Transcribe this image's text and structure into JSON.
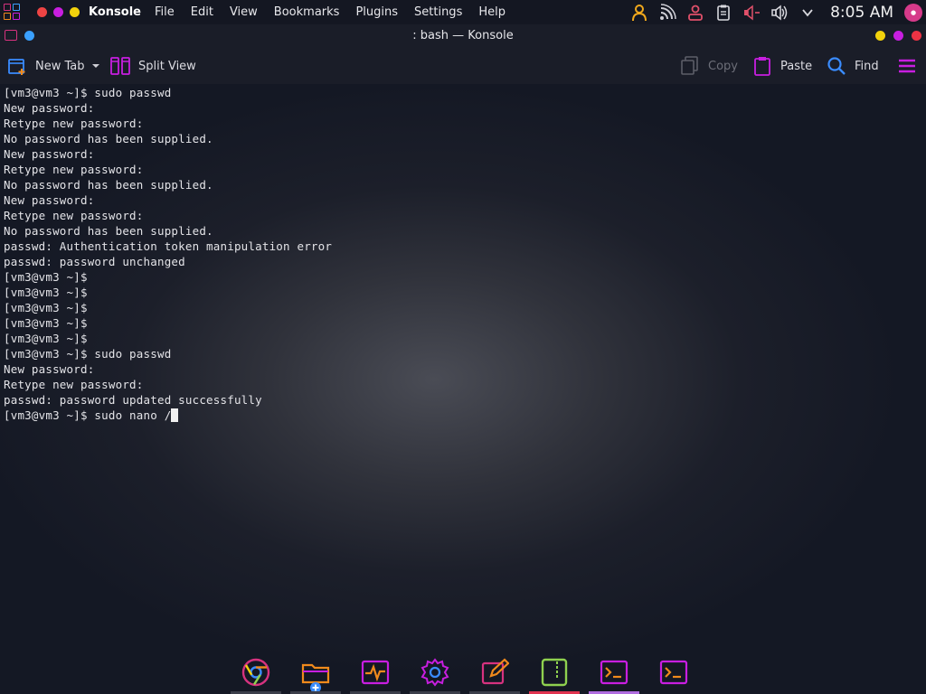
{
  "topbar": {
    "app_name": "Konsole",
    "menu": [
      "File",
      "Edit",
      "View",
      "Bookmarks",
      "Plugins",
      "Settings",
      "Help"
    ],
    "clock": "8:05 AM",
    "tray_icons": [
      "user-icon",
      "wifi-icon",
      "person-icon",
      "clipboard-icon",
      "microphone-icon",
      "volume-icon",
      "chevron-down-icon"
    ]
  },
  "window": {
    "title": ": bash — Konsole",
    "traffic_colors": [
      "#ee4444",
      "#c81ee0",
      "#f2d20c"
    ],
    "right_buttons": [
      "#f2d20c",
      "#c81ee0",
      "#ee3344"
    ]
  },
  "toolbar": {
    "new_tab": "New Tab",
    "split_view": "Split View",
    "copy": "Copy",
    "paste": "Paste",
    "find": "Find"
  },
  "terminal": {
    "lines": [
      "[vm3@vm3 ~]$ sudo passwd",
      "New password:",
      "Retype new password:",
      "No password has been supplied.",
      "New password:",
      "Retype new password:",
      "No password has been supplied.",
      "New password:",
      "Retype new password:",
      "No password has been supplied.",
      "passwd: Authentication token manipulation error",
      "passwd: password unchanged",
      "[vm3@vm3 ~]$",
      "[vm3@vm3 ~]$",
      "[vm3@vm3 ~]$",
      "[vm3@vm3 ~]$",
      "[vm3@vm3 ~]$",
      "[vm3@vm3 ~]$ sudo passwd",
      "New password:",
      "Retype new password:",
      "passwd: password updated successfully"
    ],
    "current_line": "[vm3@vm3 ~]$ sudo nano /"
  },
  "dock": {
    "items": [
      "chrome-icon",
      "files-icon",
      "system-monitor-icon",
      "settings-icon",
      "text-editor-icon",
      "archive-icon",
      "terminal-icon",
      "terminal-icon"
    ]
  },
  "colors": {
    "accent_pink": "#d6327f",
    "accent_purple": "#c81ee0",
    "accent_orange": "#f08a1c",
    "find_blue": "#3a8cff"
  }
}
